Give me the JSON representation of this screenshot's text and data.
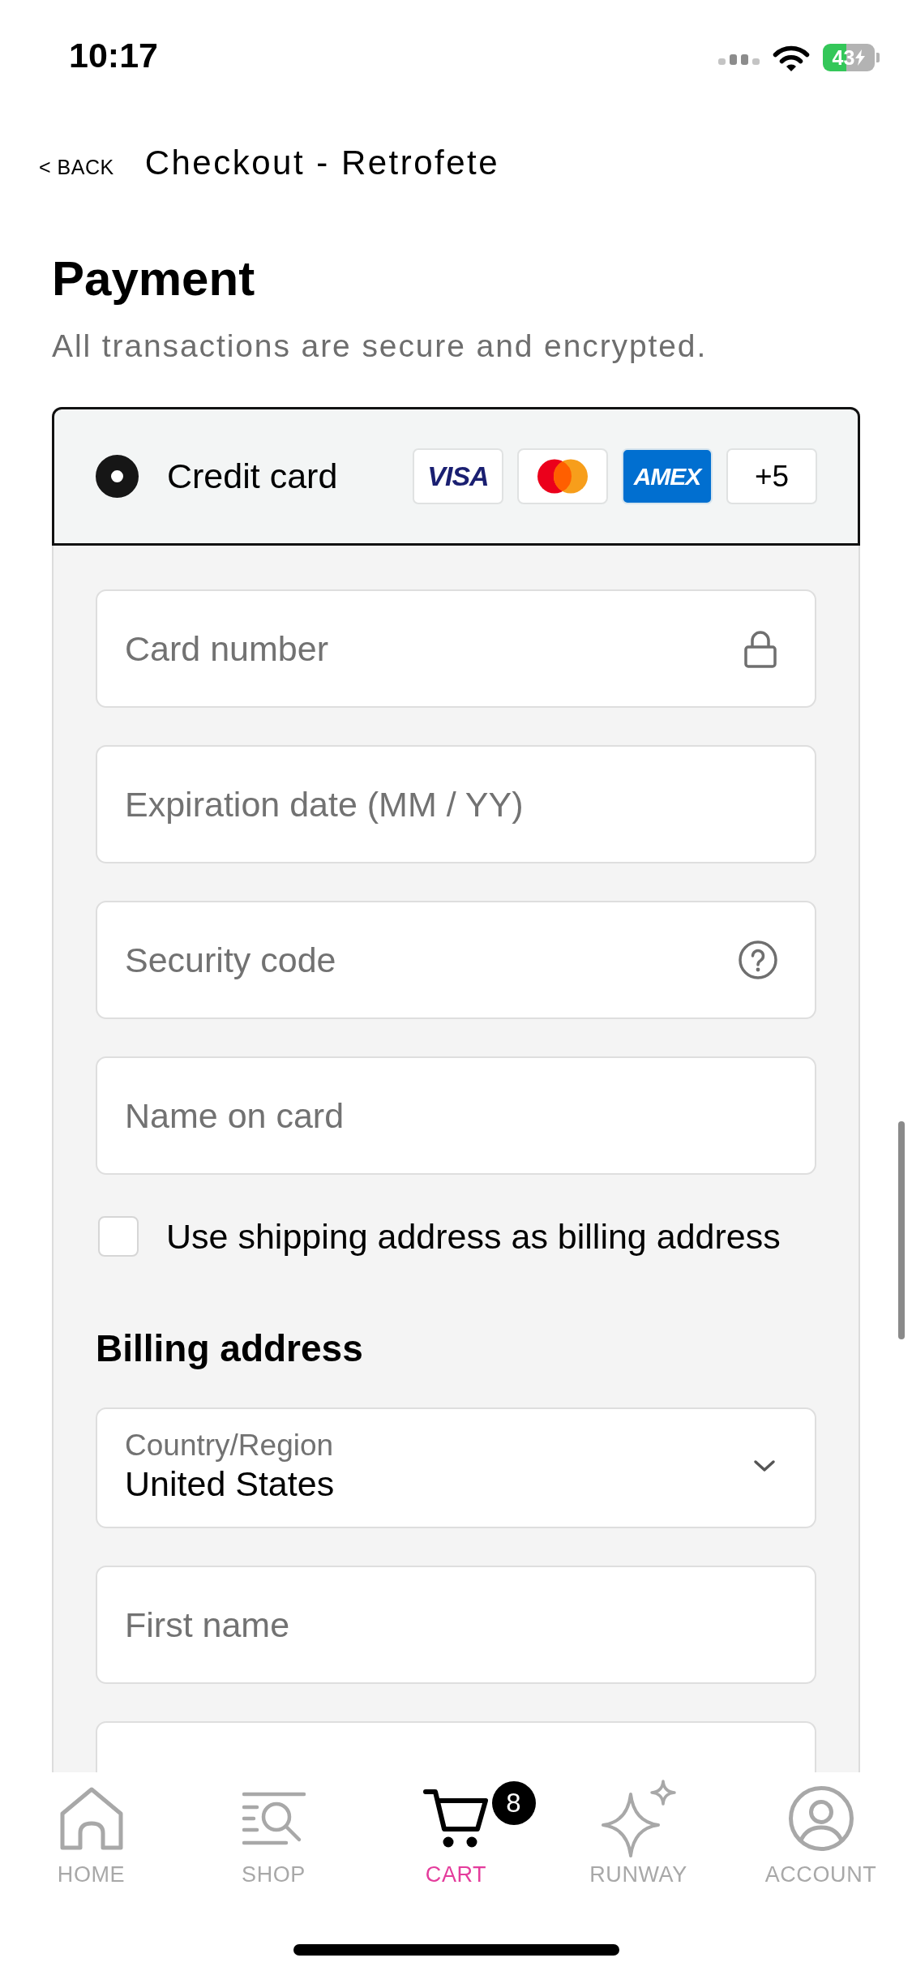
{
  "status_bar": {
    "time": "10:17",
    "battery": "43"
  },
  "nav": {
    "back": "< BACK",
    "title": "Checkout - Retrofete"
  },
  "payment": {
    "title": "Payment",
    "subtitle": "All transactions are secure and encrypted.",
    "method": {
      "label": "Credit card",
      "selected": true,
      "brands": [
        {
          "kind": "visa",
          "label": "VISA"
        },
        {
          "kind": "mastercard"
        },
        {
          "kind": "amex",
          "label": "AMEX"
        },
        {
          "kind": "more",
          "label": "+5"
        }
      ]
    },
    "card_fields": [
      {
        "kind": "number",
        "placeholder": "Card number"
      },
      {
        "kind": "expiry",
        "placeholder": "Expiration date (MM / YY)"
      },
      {
        "kind": "cvc",
        "placeholder": "Security code"
      },
      {
        "kind": "name",
        "placeholder": "Name on card"
      }
    ],
    "same_as_shipping": {
      "label": "Use shipping address as billing address",
      "checked": false
    },
    "billing": {
      "title": "Billing address",
      "country": {
        "label": "Country/Region",
        "value": "United States"
      },
      "fields": [
        {
          "placeholder": "First name"
        }
      ]
    }
  },
  "tabs": [
    {
      "label": "HOME",
      "selected": false
    },
    {
      "label": "SHOP",
      "selected": false
    },
    {
      "label": "CART",
      "selected": true,
      "badge": "8"
    },
    {
      "label": "RUNWAY",
      "selected": false
    },
    {
      "label": "ACCOUNT",
      "selected": false
    }
  ]
}
